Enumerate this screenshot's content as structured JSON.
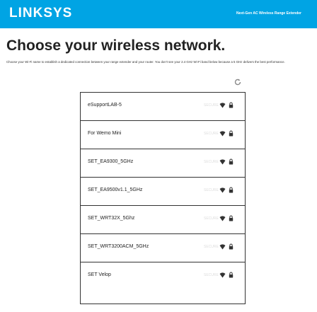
{
  "header": {
    "brand": "LINKSYS",
    "product_name": "Next-Gen AC Wireless Range Extender"
  },
  "main": {
    "title": "Choose your wireless network.",
    "description": "Choose your Wi-Fi name to establish a dedicated connection between your range extender and your router. You don't see your 2.4 GHz Wi-Fi band below because a 5 GHz delivers the best performance."
  },
  "networks": [
    {
      "ssid": "eSupportLAB-5",
      "security": "SECURE"
    },
    {
      "ssid": "For Wemo Mini",
      "security": "SECURE"
    },
    {
      "ssid": "SET_EA9300_5GHz",
      "security": "SECURE"
    },
    {
      "ssid": "SET_EA9500v1.1_5GHz",
      "security": "SECURE"
    },
    {
      "ssid": "SET_WRT32X_5Ghz",
      "security": "SECURE"
    },
    {
      "ssid": "SET_WRT3200ACM_5GHz",
      "security": "SECURE"
    },
    {
      "ssid": "SET Velop",
      "security": "SECURE"
    }
  ],
  "colors": {
    "accent": "#00a4e4",
    "text": "#222222",
    "icon": "#333333"
  }
}
